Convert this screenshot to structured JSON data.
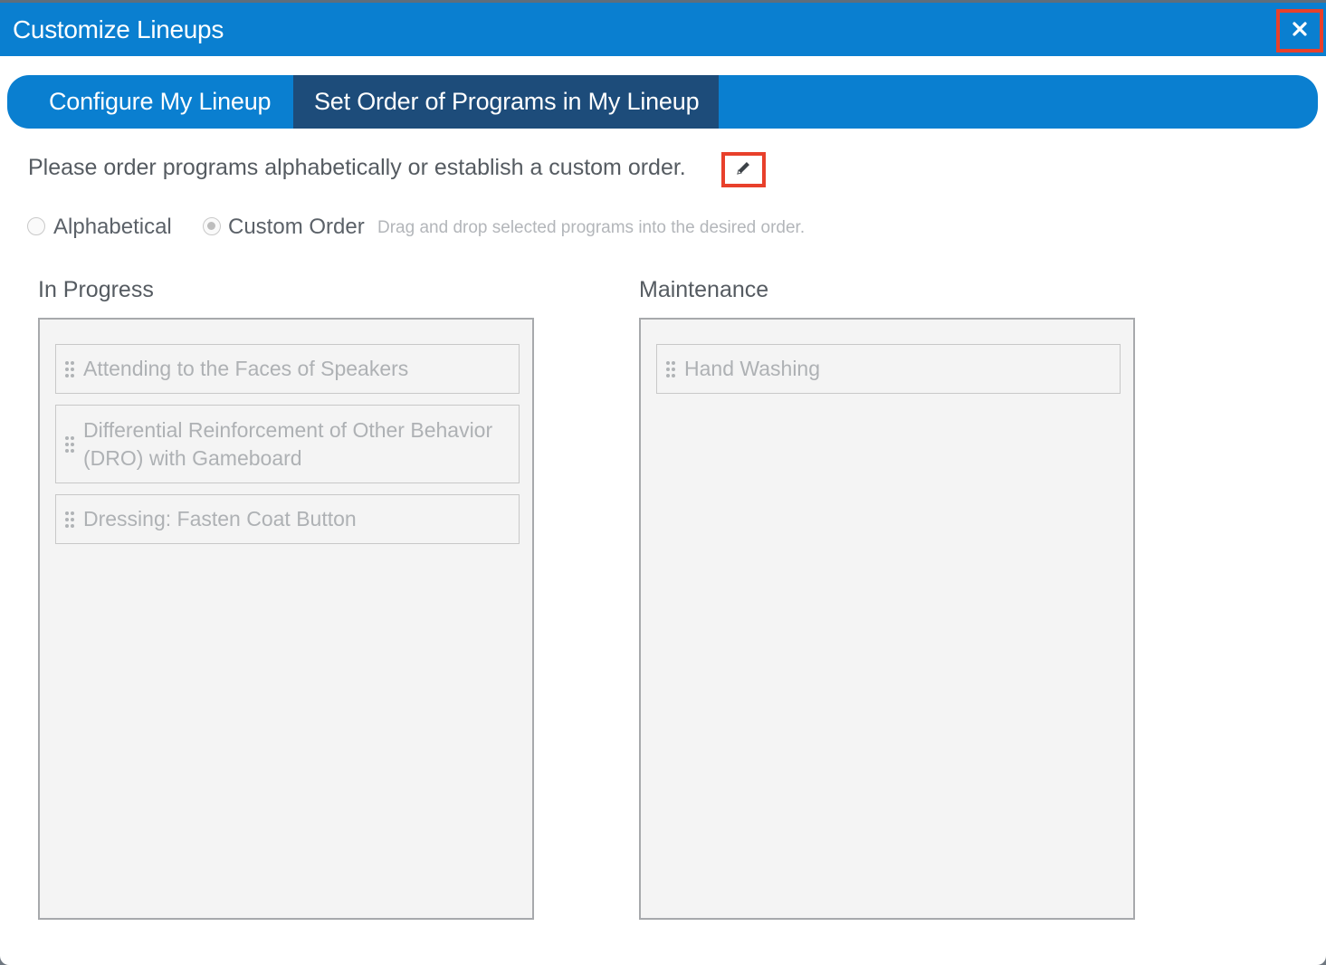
{
  "dialog": {
    "title": "Customize Lineups",
    "close_icon": "close-icon"
  },
  "tabs": [
    {
      "label": "Configure My Lineup",
      "active": false
    },
    {
      "label": "Set Order of Programs in My Lineup",
      "active": true
    }
  ],
  "instruction": {
    "text": "Please order programs alphabetically or establish a custom order.",
    "edit_icon": "pencil-icon"
  },
  "ordering": {
    "options": [
      {
        "label": "Alphabetical",
        "selected": false
      },
      {
        "label": "Custom Order",
        "selected": true
      }
    ],
    "hint": "Drag and drop selected programs into the desired order."
  },
  "columns": [
    {
      "title": "In Progress",
      "programs": [
        "Attending to the Faces of Speakers",
        "Differential Reinforcement of Other Behavior (DRO) with Gameboard",
        "Dressing: Fasten Coat Button"
      ]
    },
    {
      "title": "Maintenance",
      "programs": [
        "Hand Washing"
      ]
    }
  ],
  "colors": {
    "header_blue": "#0a7fd0",
    "active_tab": "#1d4c7a",
    "highlight_red": "#e8402b"
  }
}
